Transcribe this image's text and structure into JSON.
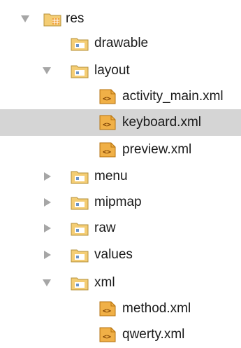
{
  "colors": {
    "selected_row": "#d5d5d5",
    "arrow": "#a6a6a6",
    "folder_fill": "#f4cd74",
    "folder_stroke": "#b59039",
    "folder_inner": "#ffffff",
    "folder_blue": "#6b94c8",
    "xml_fill": "#f0b047",
    "xml_stroke": "#b6720c",
    "xml_glyph": "#7a3e00",
    "res_grid": "#f0a33d"
  },
  "tree": {
    "res": {
      "label": "res",
      "expanded": true,
      "icon": "resource-folder-icon"
    },
    "drawable": {
      "label": "drawable",
      "icon": "folder-icon"
    },
    "layout": {
      "label": "layout",
      "expanded": true,
      "icon": "folder-icon",
      "files": [
        {
          "label": "activity_main.xml",
          "icon": "xml-file-icon",
          "selected": false
        },
        {
          "label": "keyboard.xml",
          "icon": "xml-file-icon",
          "selected": true
        },
        {
          "label": "preview.xml",
          "icon": "xml-file-icon",
          "selected": false
        }
      ]
    },
    "menu": {
      "label": "menu",
      "expanded": false,
      "icon": "folder-icon"
    },
    "mipmap": {
      "label": "mipmap",
      "expanded": false,
      "icon": "folder-icon"
    },
    "raw": {
      "label": "raw",
      "expanded": false,
      "icon": "folder-icon"
    },
    "values": {
      "label": "values",
      "expanded": false,
      "icon": "folder-icon"
    },
    "xml": {
      "label": "xml",
      "expanded": true,
      "icon": "folder-icon",
      "files": [
        {
          "label": "method.xml",
          "icon": "xml-file-icon"
        },
        {
          "label": "qwerty.xml",
          "icon": "xml-file-icon"
        }
      ]
    }
  }
}
